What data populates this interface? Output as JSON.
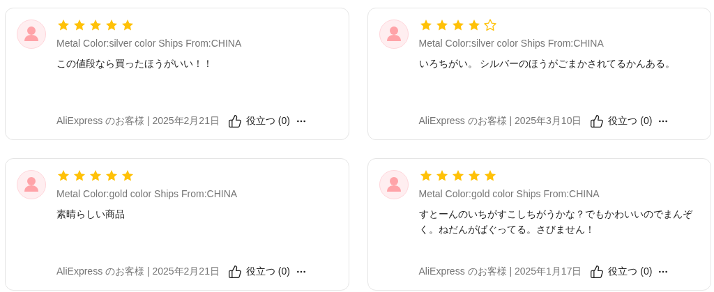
{
  "reviews": [
    {
      "stars": 5,
      "spec": "Metal Color:silver color Ships From:CHINA",
      "text": "この値段なら買ったほうがいい！！",
      "meta": "AliExpress のお客様 | 2025年2月21日",
      "helpful": "役立つ (0)"
    },
    {
      "stars": 4,
      "spec": "Metal Color:silver color Ships From:CHINA",
      "text": "いろちがい。 シルバーのほうがごまかされてるかんある。",
      "meta": "AliExpress のお客様 | 2025年3月10日",
      "helpful": "役立つ (0)"
    },
    {
      "stars": 5,
      "spec": "Metal Color:gold color Ships From:CHINA",
      "text": "素晴らしい商品",
      "meta": "AliExpress のお客様 | 2025年2月21日",
      "helpful": "役立つ (0)"
    },
    {
      "stars": 5,
      "spec": "Metal Color:gold color Ships From:CHINA",
      "text": "すとーんのいちがすこしちがうかな？でもかわいいのでまんぞく。ねだんがばぐってる。さびません！",
      "meta": "AliExpress のお客様 | 2025年1月17日",
      "helpful": "役立つ (0)"
    }
  ]
}
